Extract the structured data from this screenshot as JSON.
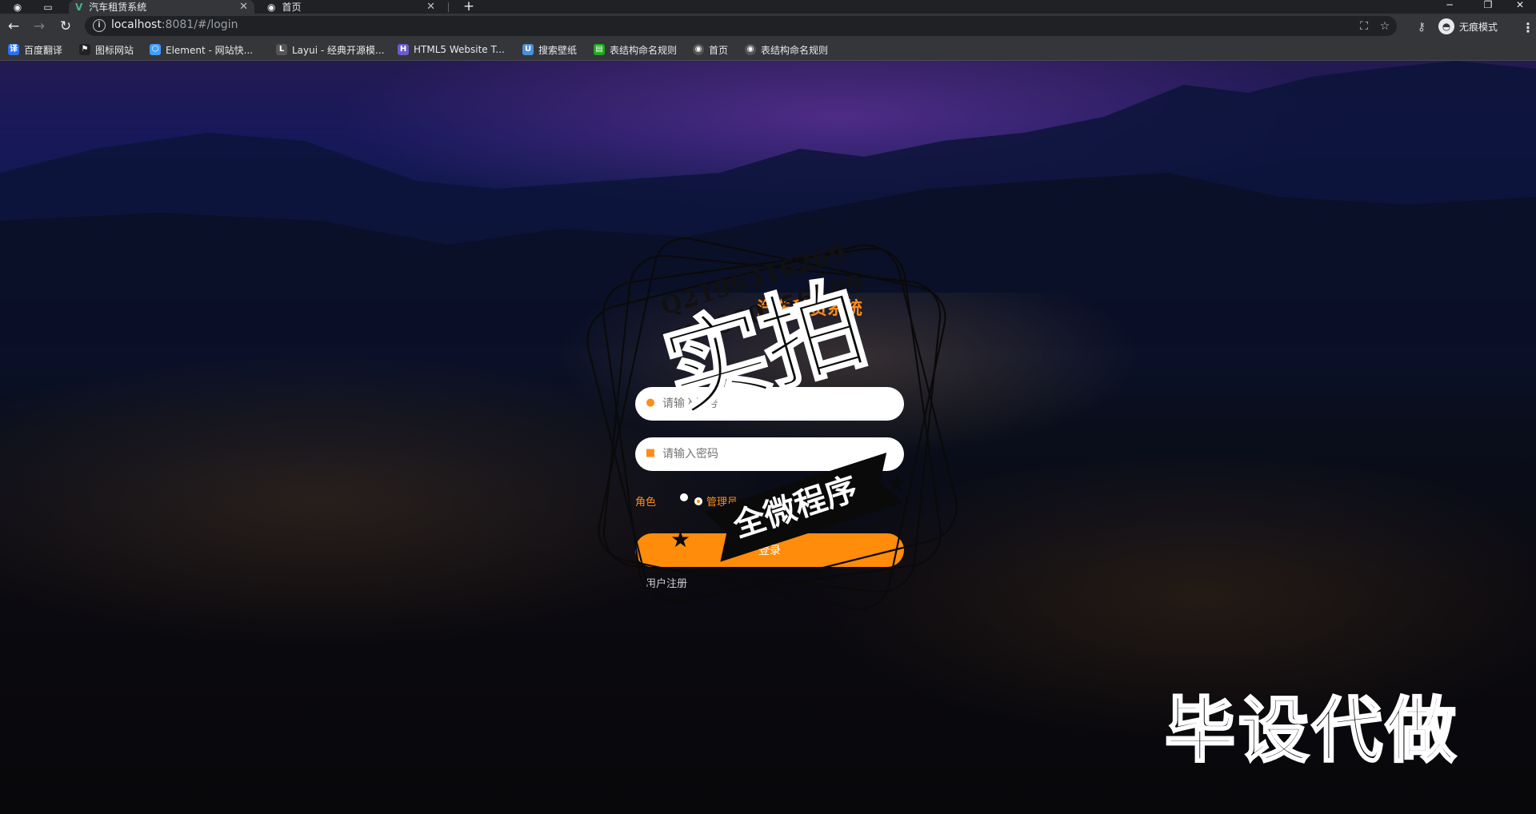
{
  "browser": {
    "tabs": [
      {
        "title": "汽车租赁系统",
        "active": true,
        "favicon": "vue-logo-icon",
        "close": "✕"
      },
      {
        "title": "首页",
        "active": false,
        "favicon": "globe-icon",
        "close": "✕"
      }
    ],
    "new_tab": "+",
    "window_controls": {
      "minimize": "─",
      "restore": "❐",
      "close": "✕"
    },
    "url_host": "localhost",
    "url_rest": ":8081/#/login",
    "profile_label": "无痕模式",
    "bookmarks": [
      {
        "label": "百度翻译",
        "icon": "translate-icon",
        "color": "#2b6ff5"
      },
      {
        "label": "图标网站",
        "icon": "flag-icon",
        "color": "#222222"
      },
      {
        "label": "Element - 网站快...",
        "icon": "element-hexagon-icon",
        "color": "#409eff"
      },
      {
        "label": "Layui - 经典开源模...",
        "icon": "layui-icon",
        "color": "#555555"
      },
      {
        "label": "HTML5 Website T...",
        "icon": "html5-template-icon",
        "color": "#6a5acd"
      },
      {
        "label": "搜索壁纸",
        "icon": "wallpaper-icon",
        "color": "#4a90d9"
      },
      {
        "label": "表结构命名规则",
        "icon": "doc-icon",
        "color": "#1aad19"
      },
      {
        "label": "首页",
        "icon": "globe-icon",
        "color": "#555555"
      },
      {
        "label": "表结构命名规则",
        "icon": "globe-icon",
        "color": "#555555"
      }
    ]
  },
  "login": {
    "title": "汽车租赁系统",
    "username_placeholder": "请输入账号",
    "password_placeholder": "请输入密码",
    "role_label": "角色",
    "roles": [
      {
        "label": "",
        "checked": false
      },
      {
        "label": "管理员",
        "checked": true
      }
    ],
    "login_button": "登录",
    "register_link": "用户注册"
  },
  "watermark": {
    "qq": "Q2196316269",
    "wechat": "V17060256499",
    "big_text": "实拍",
    "ribbon_text": "全微程序",
    "bottom_text": "毕设代做"
  },
  "colors": {
    "accent": "#ff8c0a",
    "chrome_dark": "#202124",
    "chrome": "#35363a"
  }
}
